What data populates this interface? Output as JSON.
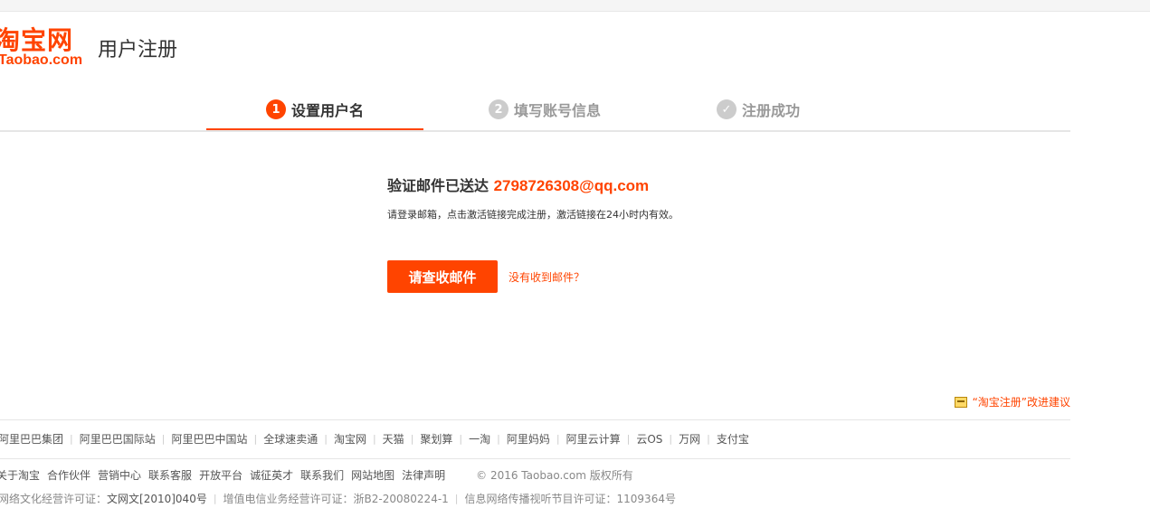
{
  "header": {
    "logo_text": "淘宝网",
    "logo_sub": "Taobao.com",
    "page_title": "用户注册"
  },
  "steps": [
    {
      "num": "1",
      "label": "设置用户名",
      "active": true
    },
    {
      "num": "2",
      "label": "填写账号信息",
      "active": false
    },
    {
      "num": "✓",
      "label": "注册成功",
      "active": false
    }
  ],
  "main": {
    "title_prefix": "验证邮件已送达",
    "email": "2798726308@qq.com",
    "description": "请登录邮箱，点击激活链接完成注册，激活链接在24小时内有效。",
    "check_button": "请查收邮件",
    "resend_link": "没有收到邮件？"
  },
  "feedback": {
    "label": "“淘宝注册”改进建议",
    "icon": "feedback-icon"
  },
  "footer": {
    "group_links": [
      "阿里巴巴集团",
      "阿里巴巴国际站",
      "阿里巴巴中国站",
      "全球速卖通",
      "淘宝网",
      "天猫",
      "聚划算",
      "一淘",
      "阿里妈妈",
      "阿里云计算",
      "云OS",
      "万网",
      "支付宝"
    ],
    "about_links": [
      "关于淘宝",
      "合作伙伴",
      "营销中心",
      "联系客服",
      "开放平台",
      "诚征英才",
      "联系我们",
      "网站地图",
      "法律声明"
    ],
    "copyright": "© 2016 Taobao.com 版权所有",
    "license_1_label": "网络文化经营许可证：",
    "license_1_value": "文网文[2010]040号",
    "license_2": "增值电信业务经营许可证：浙B2-20080224-1",
    "license_3": "信息网络传播视听节目许可证：1109364号"
  },
  "colors": {
    "accent": "#ff4400",
    "inactive_step": "#cccccc"
  }
}
